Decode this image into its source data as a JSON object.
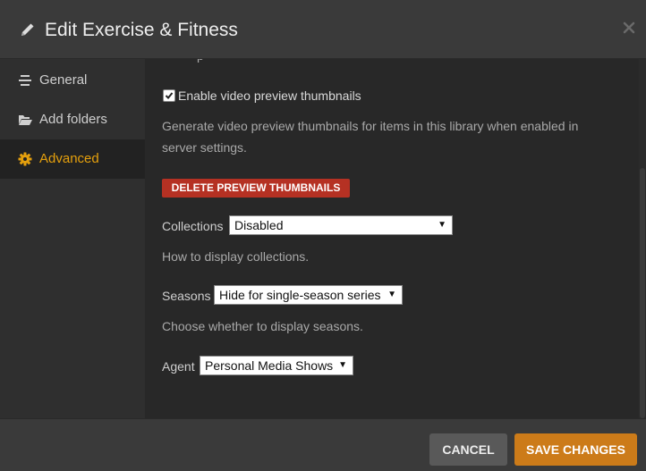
{
  "header": {
    "title": "Edit Exercise & Fitness",
    "title_icon": "pencil-icon",
    "close_icon": "close-icon"
  },
  "sidebar": {
    "items": [
      {
        "label": "General",
        "icon": "list-icon",
        "active": false
      },
      {
        "label": "Add folders",
        "icon": "folder-icon",
        "active": false
      },
      {
        "label": "Advanced",
        "icon": "gear-icon",
        "active": true
      }
    ]
  },
  "content": {
    "cut_off_text": "p",
    "video_preview": {
      "checked": true,
      "label": "Enable video preview thumbnails",
      "help_line1": "Generate video preview thumbnails for items in this library when enabled in",
      "help_line2": "server settings."
    },
    "delete_button_label": "DELETE PREVIEW THUMBNAILS",
    "collections": {
      "label": "Collections",
      "value": "Disabled",
      "help": "How to display collections."
    },
    "seasons": {
      "label": "Seasons",
      "value": "Hide for single-season series",
      "help": "Choose whether to display seasons."
    },
    "agent": {
      "label": "Agent",
      "value": "Personal Media Shows"
    }
  },
  "footer": {
    "cancel_label": "CANCEL",
    "save_label": "SAVE CHANGES"
  },
  "colors": {
    "accent": "#e5a00d",
    "save": "#cc7b19",
    "danger": "#b53123",
    "background": "#282828"
  }
}
